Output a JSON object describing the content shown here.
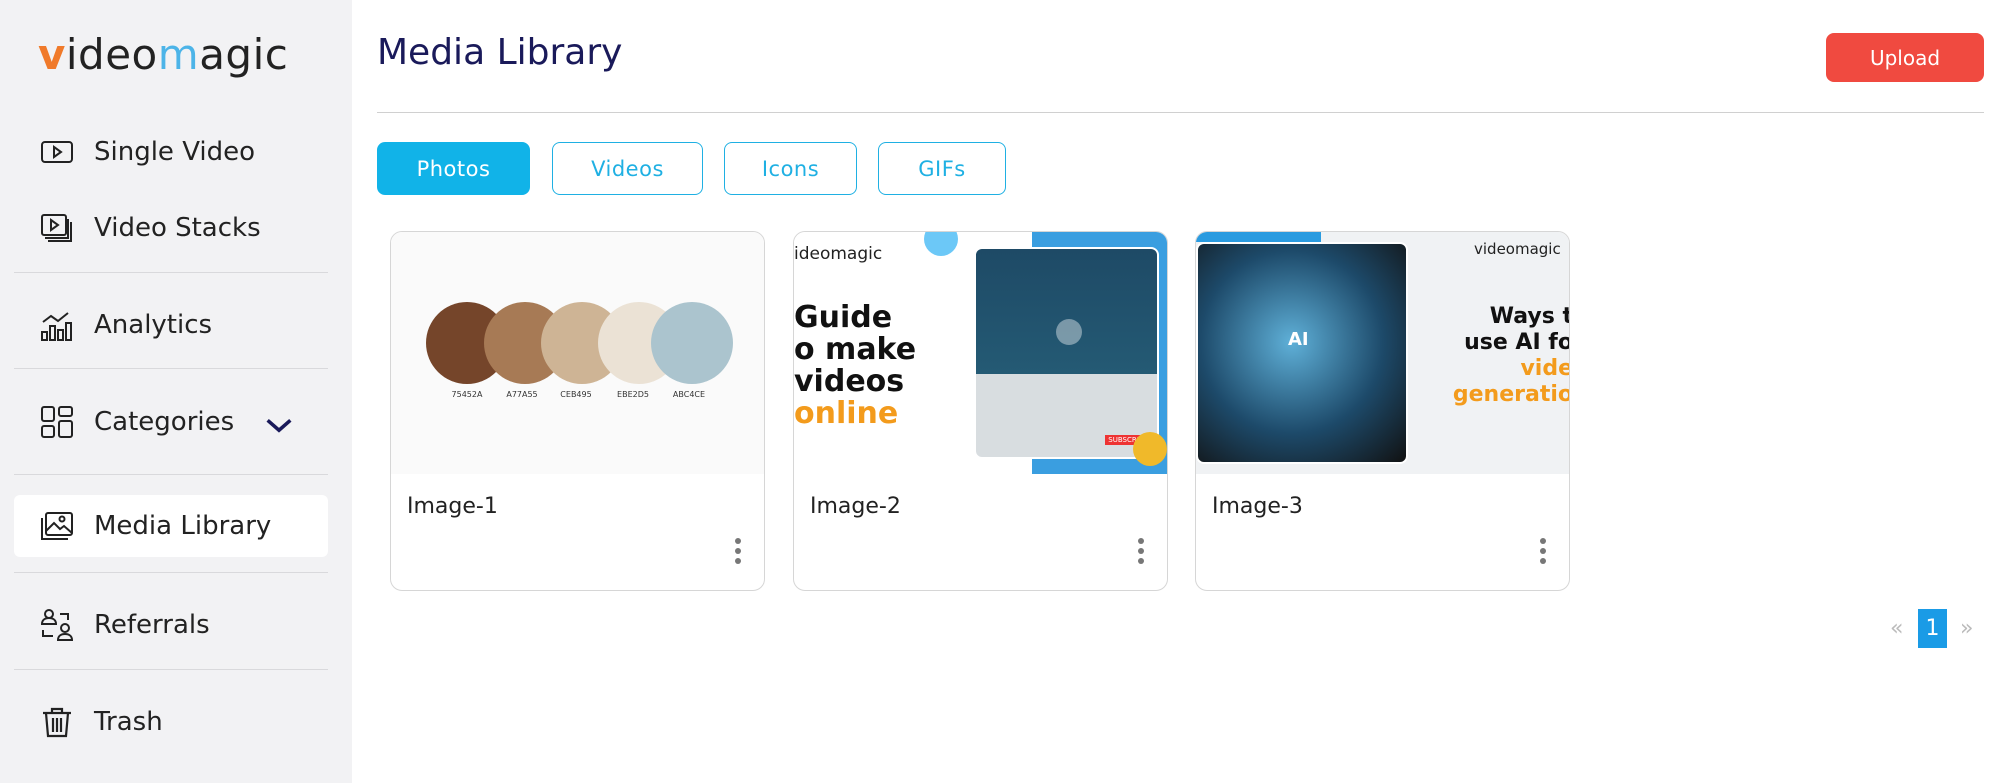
{
  "logo": {
    "v": "v",
    "ideo": "ideo",
    "m": "m",
    "agic": "agic"
  },
  "sidebar": {
    "items": [
      {
        "label": "Single Video",
        "icon": "play-video-icon"
      },
      {
        "label": "Video Stacks",
        "icon": "video-stack-icon"
      },
      {
        "label": "Analytics",
        "icon": "analytics-icon"
      },
      {
        "label": "Categories",
        "icon": "grid-icon"
      },
      {
        "label": "Media Library",
        "icon": "image-gallery-icon",
        "active": true
      },
      {
        "label": "Referrals",
        "icon": "referrals-icon"
      },
      {
        "label": "Trash",
        "icon": "trash-icon"
      }
    ]
  },
  "header": {
    "title": "Media Library",
    "upload_label": "Upload"
  },
  "tabs": [
    {
      "label": "Photos",
      "active": true
    },
    {
      "label": "Videos"
    },
    {
      "label": "Icons"
    },
    {
      "label": "GIFs"
    }
  ],
  "media": [
    {
      "name": "Image-1",
      "swatches": [
        {
          "hex": "#75452A",
          "label": "75452A"
        },
        {
          "hex": "#A77A55",
          "label": "A77A55"
        },
        {
          "hex": "#CEB495",
          "label": "CEB495"
        },
        {
          "hex": "#EBE2D5",
          "label": "EBE2D5"
        },
        {
          "hex": "#ABC4CE",
          "label": "ABC4CE"
        }
      ]
    },
    {
      "name": "Image-2",
      "thumb_text": {
        "brand": "ideomagic",
        "l1": "Guide",
        "l2": "o make",
        "l3": "videos",
        "l4": "online",
        "subscribe": "SUBSCRIBE"
      }
    },
    {
      "name": "Image-3",
      "thumb_text": {
        "brand": "videomagic",
        "ai": "AI",
        "l1": "Ways t",
        "l2": "use AI fo",
        "l3": "vide",
        "l4": "generatio"
      }
    }
  ],
  "pagination": {
    "prev": "«",
    "current": "1",
    "next": "»"
  },
  "colors": {
    "accent": "#11b3e8",
    "upload": "#f04a40",
    "title": "#1a1a5a"
  }
}
